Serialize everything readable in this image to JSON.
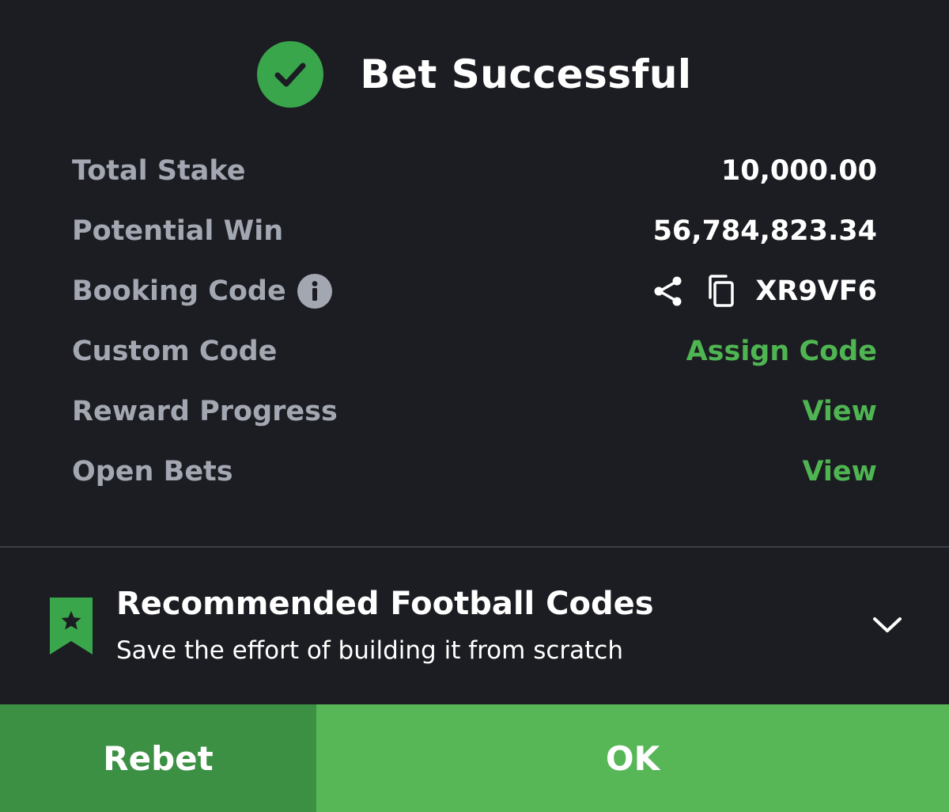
{
  "header": {
    "title": "Bet Successful",
    "icon": "check-circle-icon",
    "accent": "#3aa64b"
  },
  "summary": {
    "total_stake": {
      "label": "Total Stake",
      "value": "10,000.00"
    },
    "potential_win": {
      "label": "Potential Win",
      "value": "56,784,823.34"
    },
    "booking_code": {
      "label": "Booking Code",
      "value": "XR9VF6",
      "icons": [
        "info-icon",
        "share-icon",
        "copy-icon"
      ]
    },
    "custom_code": {
      "label": "Custom Code",
      "action": "Assign Code"
    },
    "reward_progress": {
      "label": "Reward Progress",
      "action": "View"
    },
    "open_bets": {
      "label": "Open Bets",
      "action": "View"
    }
  },
  "recommended": {
    "title": "Recommended Football Codes",
    "subtitle": "Save the effort of building it from scratch",
    "icon": "bookmark-star-icon",
    "toggle_icon": "chevron-down-icon"
  },
  "footer": {
    "rebet_label": "Rebet",
    "ok_label": "OK"
  },
  "colors": {
    "background": "#1c1d22",
    "link_green": "#4fb552",
    "rebet_bg": "#3c9043",
    "ok_bg": "#57b757"
  }
}
